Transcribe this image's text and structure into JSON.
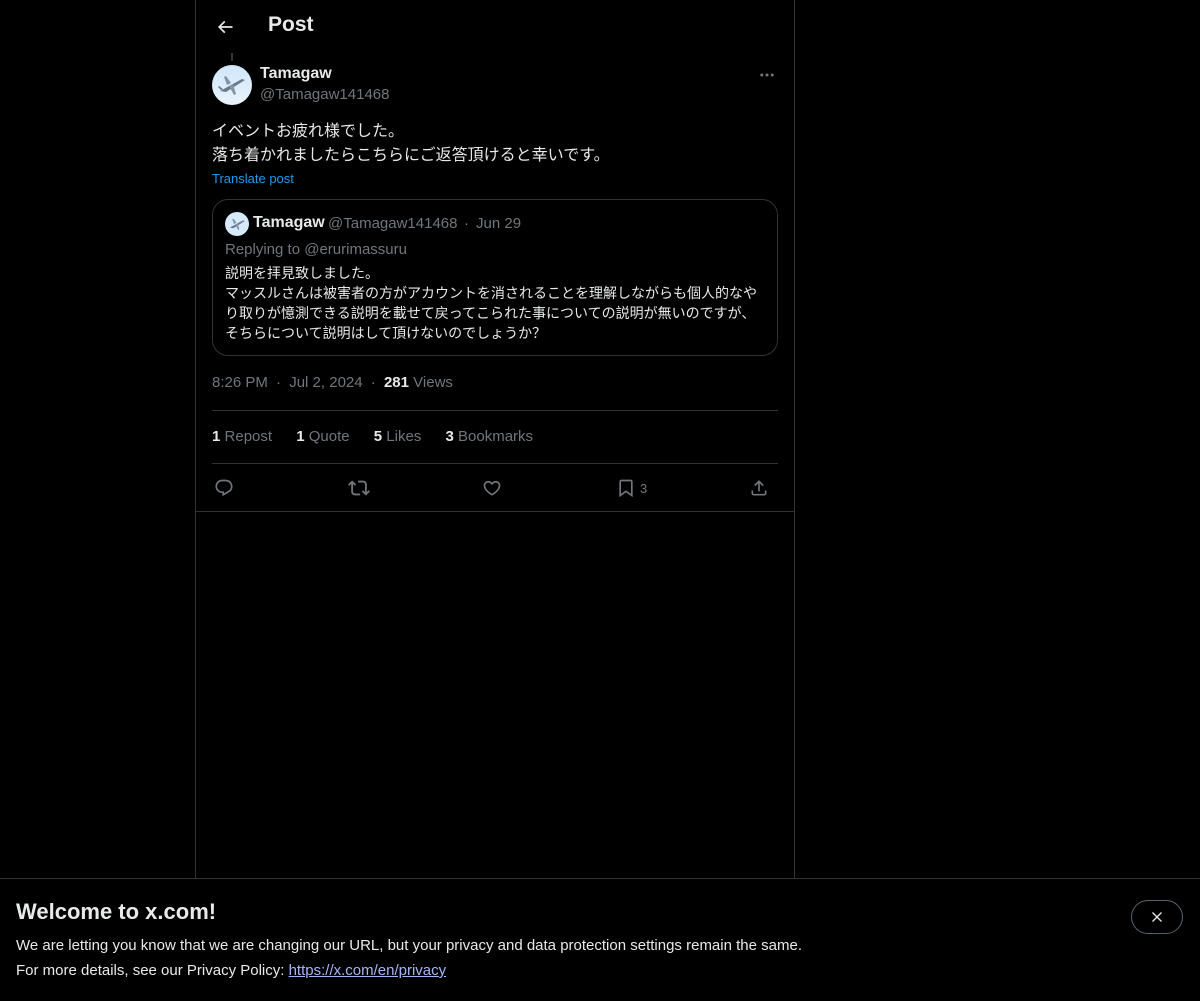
{
  "header": {
    "title": "Post"
  },
  "post": {
    "author_name": "Tamagaw",
    "author_handle": "@Tamagaw141468",
    "text_line1": "イベントお疲れ様でした。",
    "text_line2": "落ち着かれましたらこちらにご返答頂けると幸いです。",
    "translate": "Translate post",
    "time": "8:26 PM",
    "date": "Jul 2, 2024",
    "views_count": "281",
    "views_label": "Views",
    "sep": "·"
  },
  "quote": {
    "author_name": "Tamagaw",
    "author_handle": "@Tamagaw141468",
    "sep": "·",
    "date": "Jun 29",
    "replying": "Replying to @erurimassuru",
    "text": "説明を拝見致しました。\nマッスルさんは被害者の方がアカウントを消されることを理解しながらも個人的なやり取りが憶測できる説明を載せて戻ってこられた事についての説明が無いのですが、そちらについて説明はして頂けないのでしょうか？"
  },
  "stats": {
    "reposts_count": "1",
    "reposts_label": "Repost",
    "quotes_count": "1",
    "quotes_label": "Quote",
    "likes_count": "5",
    "likes_label": "Likes",
    "bookmarks_count": "3",
    "bookmarks_label": "Bookmarks"
  },
  "actions": {
    "bookmark_count": "3",
    "icons": [
      "reply-icon",
      "repost-icon",
      "like-icon",
      "bookmark-icon",
      "share-icon"
    ]
  },
  "banner": {
    "title": "Welcome to x.com!",
    "line1": "We are letting you know that we are changing our URL, but your privacy and data protection settings remain the same.",
    "line2_prefix": "For more details, see our Privacy Policy: ",
    "link": "https://x.com/en/privacy"
  },
  "colors": {
    "background": "#000000",
    "text": "#e7e9ea",
    "muted": "#71767b",
    "accent": "#1d9bf0",
    "border": "#2f3336"
  }
}
